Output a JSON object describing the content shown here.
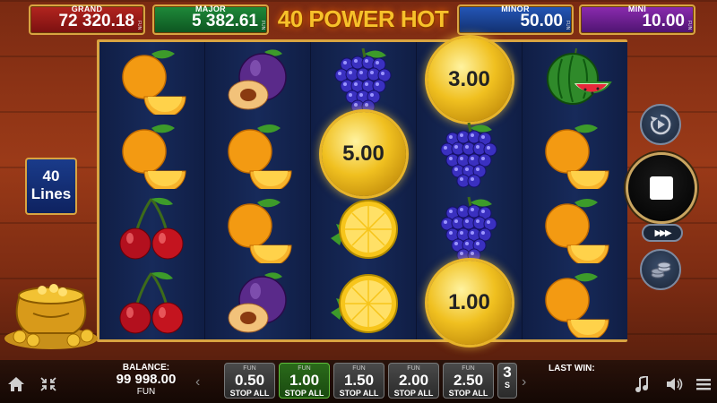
{
  "title": "40 POWER HOT",
  "jackpots": {
    "grand": {
      "label": "GRAND",
      "value": "72 320.18",
      "fun": "FUN"
    },
    "major": {
      "label": "MAJOR",
      "value": "5 382.61",
      "fun": "FUN"
    },
    "minor": {
      "label": "MINOR",
      "value": "50.00",
      "fun": "FUN"
    },
    "mini": {
      "label": "MINI",
      "value": "10.00",
      "fun": "FUN"
    }
  },
  "lines": {
    "count": "40",
    "label": "Lines"
  },
  "reels": [
    [
      "orange",
      "orange",
      "cherry",
      "cherry"
    ],
    [
      "plum",
      "orange",
      "orange",
      "plum"
    ],
    [
      "grapes",
      "coin",
      "lemon",
      "lemon"
    ],
    [
      "coin",
      "grapes",
      "grapes",
      "coin"
    ],
    [
      "watermelon",
      "orange",
      "orange",
      "orange"
    ]
  ],
  "coins": {
    "reel3_row2": "5.00",
    "reel4_row1": "3.00",
    "reel4_row4": "1.00"
  },
  "buttons": {
    "autoplay": "autoplay-icon",
    "spin": "stop-icon",
    "turbo": "▶▶▶",
    "bet_settings": "coins-icon"
  },
  "balance": {
    "label": "BALANCE:",
    "value": "99 998.00",
    "currency": "FUN"
  },
  "bets": [
    {
      "fun": "FUN",
      "value": "0.50",
      "action": "STOP ALL",
      "active": false
    },
    {
      "fun": "FUN",
      "value": "1.00",
      "action": "STOP ALL",
      "active": true
    },
    {
      "fun": "FUN",
      "value": "1.50",
      "action": "STOP ALL",
      "active": false
    },
    {
      "fun": "FUN",
      "value": "2.00",
      "action": "STOP ALL",
      "active": false
    },
    {
      "fun": "FUN",
      "value": "2.50",
      "action": "STOP ALL",
      "active": false
    },
    {
      "fun": "",
      "value": "3",
      "action": "S",
      "active": false
    }
  ],
  "last_win": {
    "label": "LAST WIN:",
    "value": ""
  },
  "nav_arrows": {
    "left": "‹",
    "right": "›"
  },
  "bottom_icons": [
    "home-icon",
    "fullscreen-icon",
    "music-icon",
    "sound-icon",
    "menu-icon"
  ]
}
